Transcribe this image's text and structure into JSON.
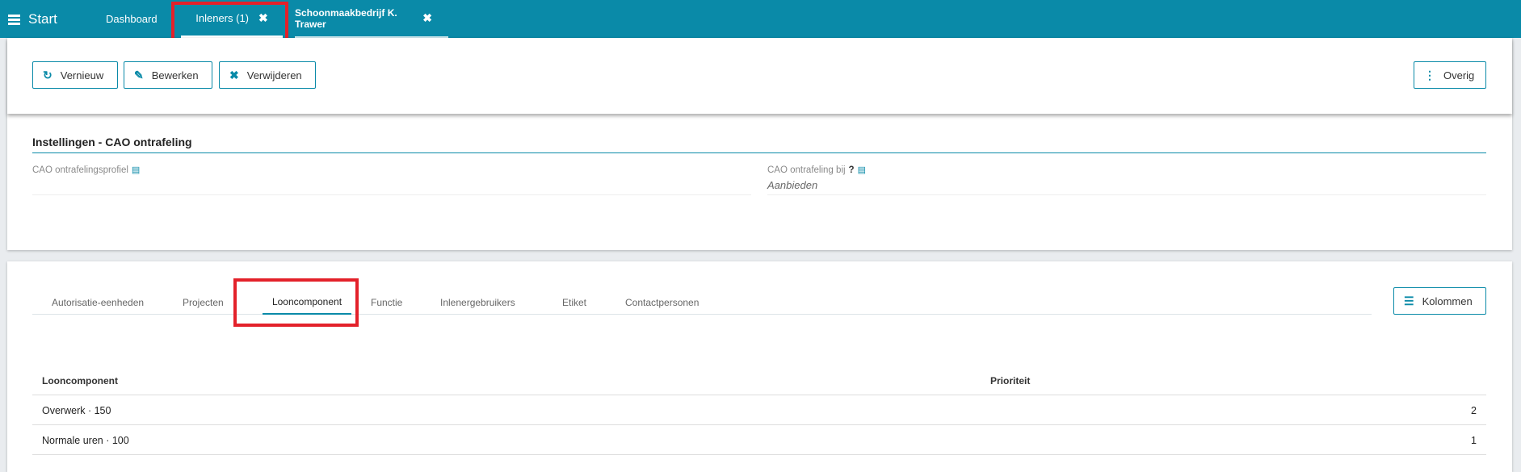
{
  "topbar": {
    "start_label": "Start",
    "tabs": [
      {
        "label": "Dashboard",
        "closable": false
      },
      {
        "label": "Inleners (1)",
        "close_icon": "✖"
      },
      {
        "label": "Schoonmaakbedrijf K. Trawer",
        "close_icon": "✖"
      }
    ]
  },
  "toolbar": {
    "refresh_label": "Vernieuw",
    "edit_label": "Bewerken",
    "delete_label": "Verwijderen",
    "more_label": "Overig",
    "refresh_icon": "↻",
    "edit_icon": "✎",
    "delete_icon": "✖",
    "more_icon": "⋮"
  },
  "settings": {
    "title": "Instellingen - CAO ontrafeling",
    "fields": [
      {
        "label": "CAO ontrafelingsprofiel",
        "value": ""
      },
      {
        "label": "CAO ontrafeling bij",
        "help": "?",
        "value": "Aanbieden"
      }
    ]
  },
  "subtabs": {
    "items": [
      {
        "label": "Autorisatie-eenheden"
      },
      {
        "label": "Projecten"
      },
      {
        "label": "Looncomponent"
      },
      {
        "label": "Functie"
      },
      {
        "label": "Inlenergebruikers"
      },
      {
        "label": "Etiket"
      },
      {
        "label": "Contactpersonen"
      }
    ],
    "active": "Looncomponent",
    "columns_button": "Kolommen",
    "columns_icon": "☰"
  },
  "table": {
    "headers": [
      "Looncomponent",
      "Prioriteit"
    ],
    "rows": [
      {
        "name": "Overwerk · 150",
        "priority": "2"
      },
      {
        "name": "Normale uren · 100",
        "priority": "1"
      }
    ]
  },
  "colors": {
    "brand": "#0a8aa8",
    "highlight": "#e3212a"
  }
}
